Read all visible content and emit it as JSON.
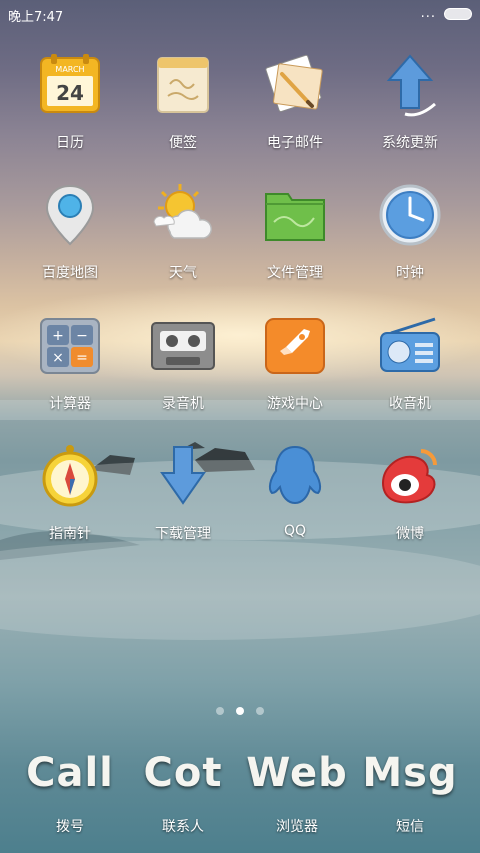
{
  "status_bar": {
    "time": "晚上7:47",
    "overflow": "..."
  },
  "apps": [
    {
      "label": "日历",
      "icon": "calendar-icon",
      "month": "MARCH",
      "day": "24"
    },
    {
      "label": "便签",
      "icon": "notes-icon"
    },
    {
      "label": "电子邮件",
      "icon": "email-icon"
    },
    {
      "label": "系统更新",
      "icon": "update-arrow-icon"
    },
    {
      "label": "百度地图",
      "icon": "map-pin-icon"
    },
    {
      "label": "天气",
      "icon": "weather-icon"
    },
    {
      "label": "文件管理",
      "icon": "folder-icon"
    },
    {
      "label": "时钟",
      "icon": "clock-icon"
    },
    {
      "label": "计算器",
      "icon": "calculator-icon"
    },
    {
      "label": "录音机",
      "icon": "cassette-icon"
    },
    {
      "label": "游戏中心",
      "icon": "rocket-icon"
    },
    {
      "label": "收音机",
      "icon": "radio-icon"
    },
    {
      "label": "指南针",
      "icon": "compass-icon"
    },
    {
      "label": "下载管理",
      "icon": "download-arrow-icon"
    },
    {
      "label": "QQ",
      "icon": "qq-penguin-icon"
    },
    {
      "label": "微博",
      "icon": "weibo-icon"
    }
  ],
  "page_indicator": {
    "count": 3,
    "active": 2
  },
  "dock": [
    {
      "word": "Call",
      "label": "拨号"
    },
    {
      "word": "Cot",
      "label": "联系人"
    },
    {
      "word": "Web",
      "label": "浏览器"
    },
    {
      "word": "Msg",
      "label": "短信"
    }
  ]
}
